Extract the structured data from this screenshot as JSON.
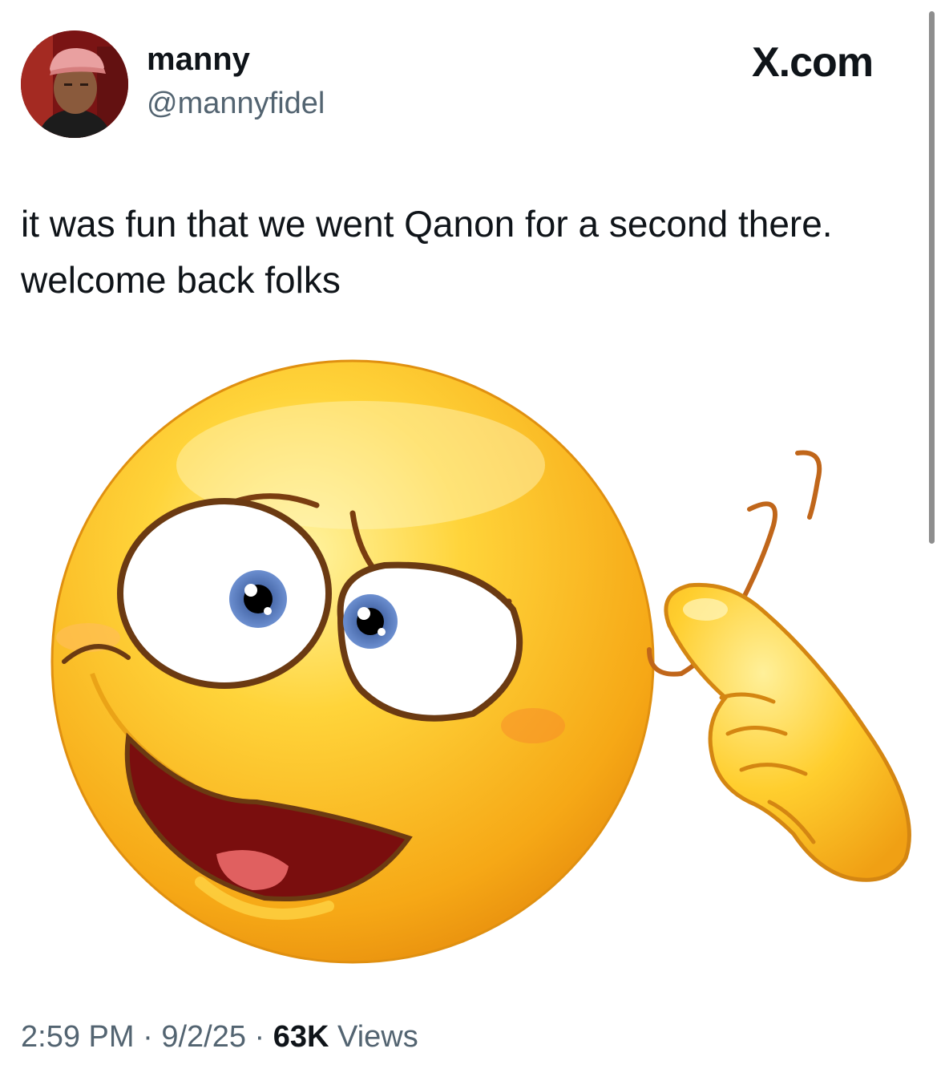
{
  "author": {
    "display_name": "manny",
    "handle": "@mannyfidel"
  },
  "brand": "X.com",
  "tweet": {
    "text": "it was fun that we went Qanon for a second there. welcome back folks"
  },
  "meta": {
    "time": "2:59 PM",
    "separator": "·",
    "date": "9/2/25",
    "views_count": "63K",
    "views_label": "Views"
  },
  "image": {
    "icon": "crazy-emoji-icon"
  }
}
